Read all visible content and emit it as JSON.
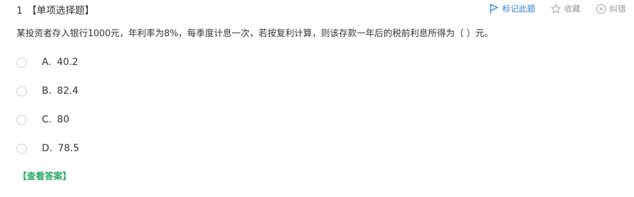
{
  "question": {
    "number": "1",
    "type_label": "【单项选择题】",
    "stem": "某投资者存入银行1000元，年利率为8%，每季度计息一次，若按复利计算，则该存款一年后的税前利息所得为（    ）元。"
  },
  "actions": {
    "mark_label": "标记此题",
    "favorite_label": "收藏",
    "report_label": "纠错"
  },
  "options": [
    {
      "letter": "A.",
      "text": "40.2"
    },
    {
      "letter": "B.",
      "text": "82.4"
    },
    {
      "letter": "C.",
      "text": "80"
    },
    {
      "letter": "D.",
      "text": "78.5"
    }
  ],
  "answer_link": "【查看答案】",
  "colors": {
    "accent_blue": "#2f7fd4",
    "answer_green": "#2aa86b",
    "muted_gray": "#999999",
    "text": "#333333"
  },
  "icons": {
    "mark": "flag-icon",
    "favorite": "star-icon",
    "report": "circle-x-icon"
  }
}
